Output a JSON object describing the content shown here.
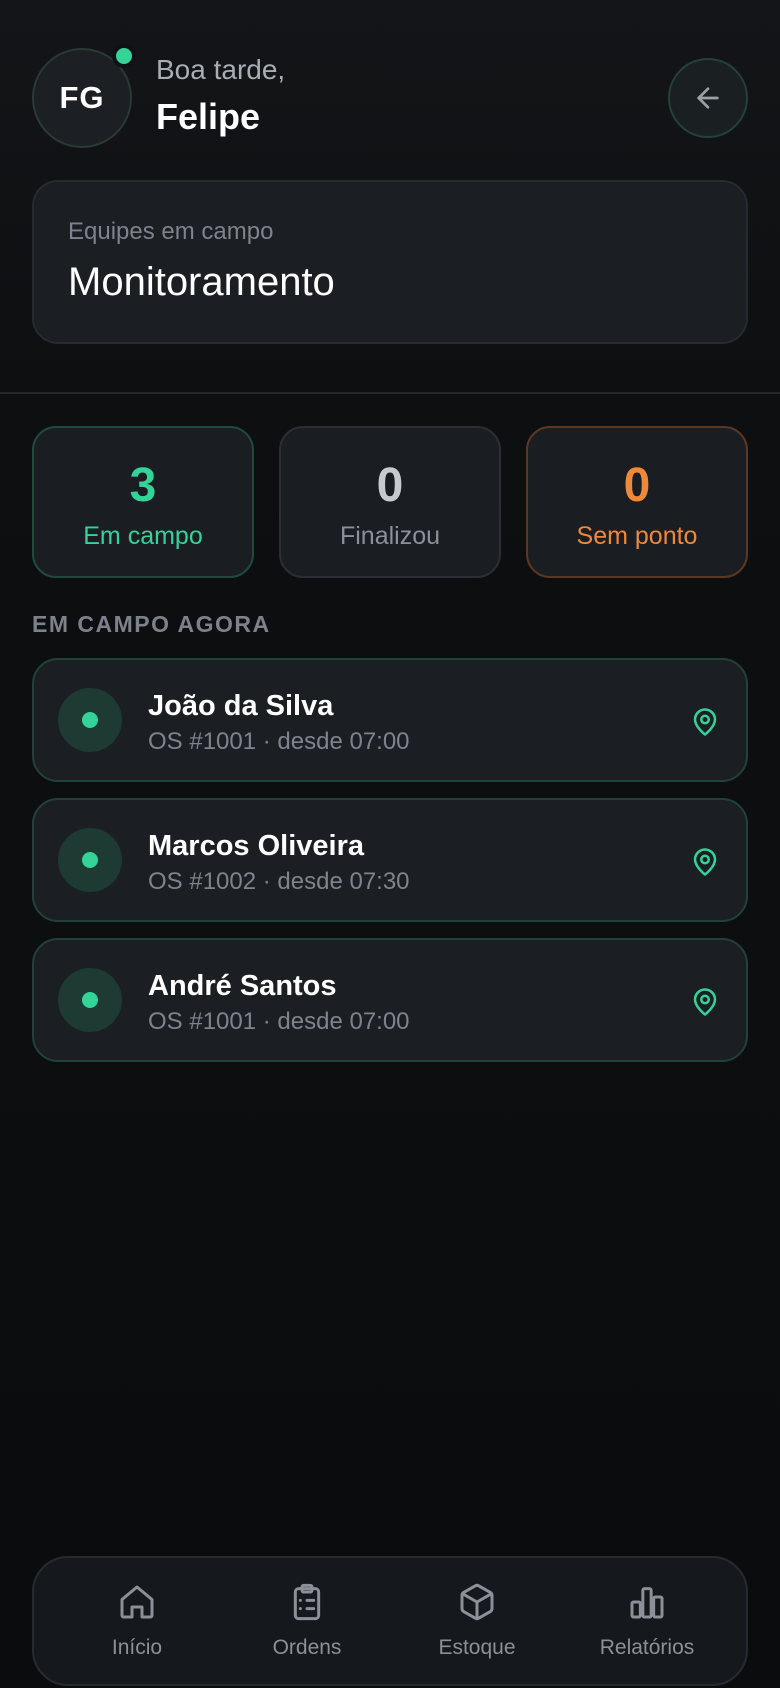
{
  "user": {
    "initials": "FG",
    "greeting": "Boa tarde,",
    "name": "Felipe",
    "online": true
  },
  "team": {
    "label": "Equipes em campo",
    "value": "Monitoramento"
  },
  "stats": [
    {
      "value": "3",
      "label": "Em campo",
      "color": "#34d399"
    },
    {
      "value": "0",
      "label": "Finalizou",
      "color": "#c6c9cf"
    },
    {
      "value": "0",
      "label": "Sem ponto",
      "color": "#f0883a"
    }
  ],
  "section_title": "EM CAMPO AGORA",
  "workers": [
    {
      "name": "João da Silva",
      "meta": "OS #1001 · desde 07:00"
    },
    {
      "name": "Marcos Oliveira",
      "meta": "OS #1002 · desde 07:30"
    },
    {
      "name": "André Santos",
      "meta": "OS #1001 · desde 07:00"
    }
  ],
  "nav": [
    {
      "label": "Início",
      "icon": "home-icon"
    },
    {
      "label": "Ordens",
      "icon": "clipboard-icon"
    },
    {
      "label": "Estoque",
      "icon": "box-icon"
    },
    {
      "label": "Relatórios",
      "icon": "bar-chart-icon"
    }
  ],
  "colors": {
    "accent": "#34d399",
    "warning": "#f0883a",
    "background": "#0d0f11",
    "card": "#1b1e23"
  }
}
